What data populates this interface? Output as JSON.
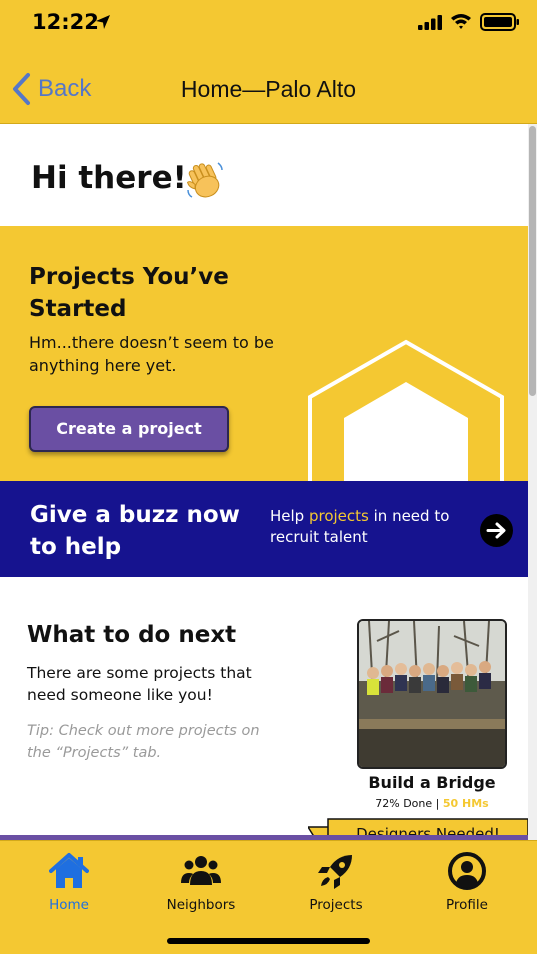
{
  "status_bar": {
    "time": "12:22"
  },
  "nav": {
    "back_label": "Back",
    "title": "Home—Palo Alto"
  },
  "greeting": {
    "text": "Hi there!"
  },
  "projects_started": {
    "title": "Projects You’ve Started",
    "empty_text": "Hm...there doesn’t seem to be anything here yet.",
    "create_button": "Create a project"
  },
  "buzz": {
    "title": "Give a buzz now to help",
    "sub_before": "Help ",
    "sub_highlight": "projects",
    "sub_after": " in need to recruit talent"
  },
  "next": {
    "title": "What to do next",
    "description": "There are some projects that need someone like you!",
    "tip": "Tip: Check out more projects on the “Projects” tab.",
    "card": {
      "ribbon": "Designers Needed!",
      "name": "Build a Bridge",
      "progress": "72% Done",
      "separator": "|",
      "hms": "50 HMs"
    }
  },
  "tabs": [
    {
      "label": "Home",
      "icon": "home-icon",
      "active": true
    },
    {
      "label": "Neighbors",
      "icon": "people-icon",
      "active": false
    },
    {
      "label": "Projects",
      "icon": "rocket-icon",
      "active": false
    },
    {
      "label": "Profile",
      "icon": "profile-icon",
      "active": false
    }
  ],
  "colors": {
    "brand_yellow": "#f4c832",
    "navy": "#16138f",
    "purple": "#6a4fa3",
    "active_blue": "#1f6fe0"
  }
}
